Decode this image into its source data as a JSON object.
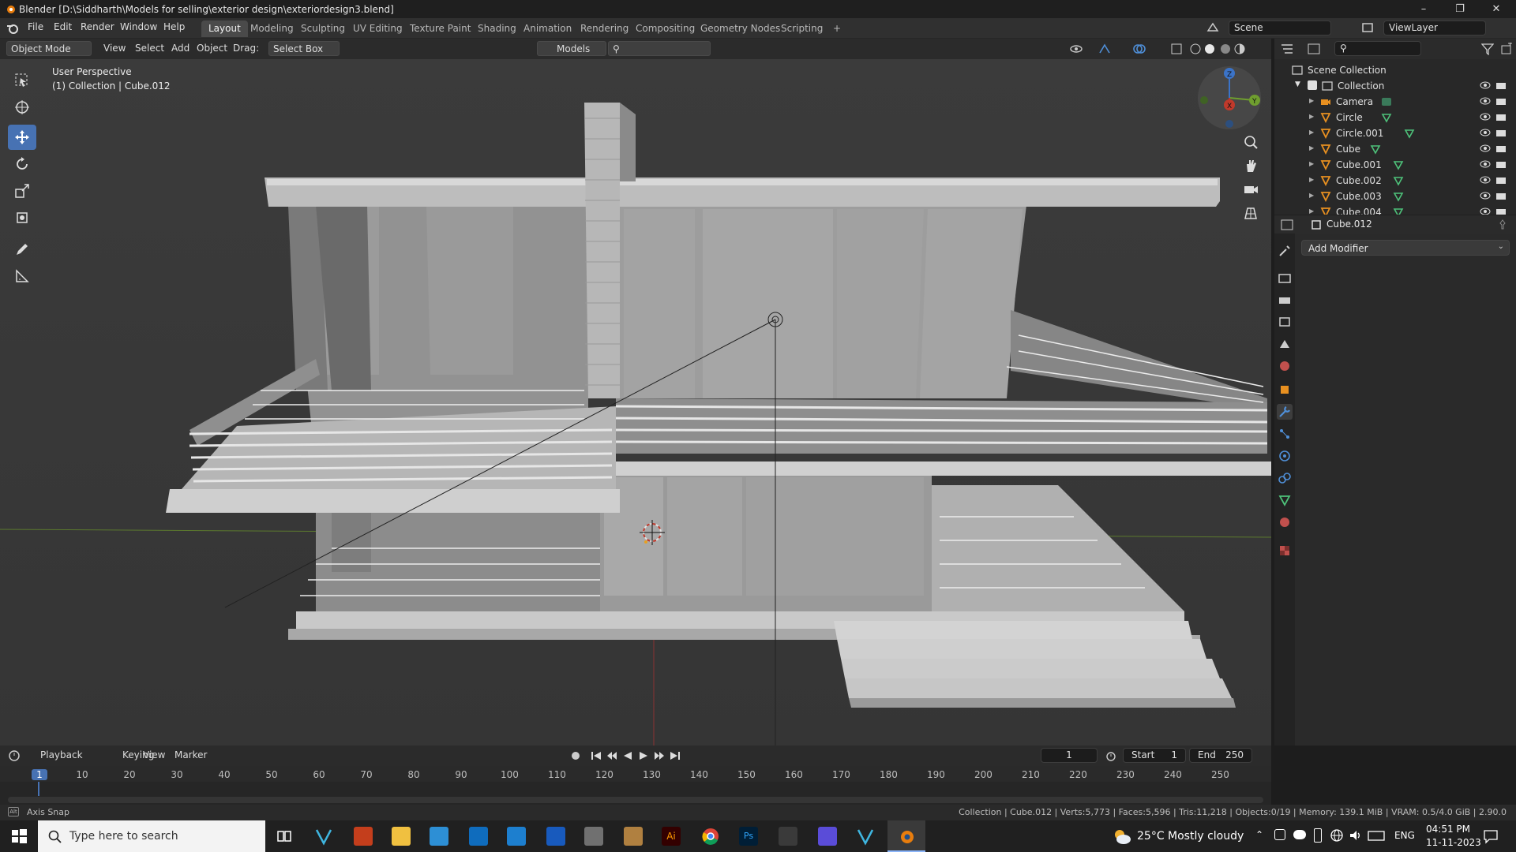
{
  "titlebar": {
    "title": "Blender [D:\\Siddharth\\Models for selling\\exterior design\\exteriordesign3.blend]"
  },
  "menus": [
    "File",
    "Edit",
    "Render",
    "Window",
    "Help"
  ],
  "workspaces": [
    "Layout",
    "Modeling",
    "Sculpting",
    "UV Editing",
    "Texture Paint",
    "Shading",
    "Animation",
    "Rendering",
    "Compositing",
    "Geometry Nodes",
    "Scripting"
  ],
  "active_workspace": "Layout",
  "scene": {
    "label": "Scene",
    "view_layer": "ViewLayer"
  },
  "header3d": {
    "mode": "Object Mode",
    "menus": [
      "View",
      "Select",
      "Add",
      "Object"
    ],
    "drag_label": "Drag:",
    "drag_value": "Select Box",
    "collection_filter": "Models"
  },
  "viewport": {
    "perspective": "User Perspective",
    "context": "(1) Collection | Cube.012"
  },
  "outliner": {
    "root": "Scene Collection",
    "collection": "Collection",
    "items": [
      "Camera",
      "Circle",
      "Circle.001",
      "Cube",
      "Cube.001",
      "Cube.002",
      "Cube.003",
      "Cube.004"
    ]
  },
  "properties": {
    "object": "Cube.012",
    "add_modifier": "Add Modifier"
  },
  "timeline": {
    "menus": [
      "Playback",
      "Keying",
      "View",
      "Marker"
    ],
    "current_frame": "1",
    "start_label": "Start",
    "start": "1",
    "end_label": "End",
    "end": "250",
    "ticks": [
      "1",
      "10",
      "20",
      "30",
      "40",
      "50",
      "60",
      "70",
      "80",
      "90",
      "100",
      "110",
      "120",
      "130",
      "140",
      "150",
      "160",
      "170",
      "180",
      "190",
      "200",
      "210",
      "220",
      "230",
      "240",
      "250"
    ]
  },
  "status": {
    "left": "Axis Snap",
    "right": "Collection | Cube.012 | Verts:5,773 | Faces:5,596 | Tris:11,218 | Objects:0/19 | Memory: 139.1 MiB | VRAM: 0.5/4.0 GiB | 2.90.0"
  },
  "taskbar": {
    "search": "Type here to search",
    "weather": "25°C  Mostly cloudy",
    "lang": "ENG",
    "time": "04:51 PM",
    "date": "11-11-2023"
  },
  "colors": {
    "accent": "#4772b3",
    "active_tab": "#4a4a4a",
    "x_axis": "#c0392b",
    "y_axis": "#6f9e2f",
    "z_axis": "#3b73c7"
  }
}
